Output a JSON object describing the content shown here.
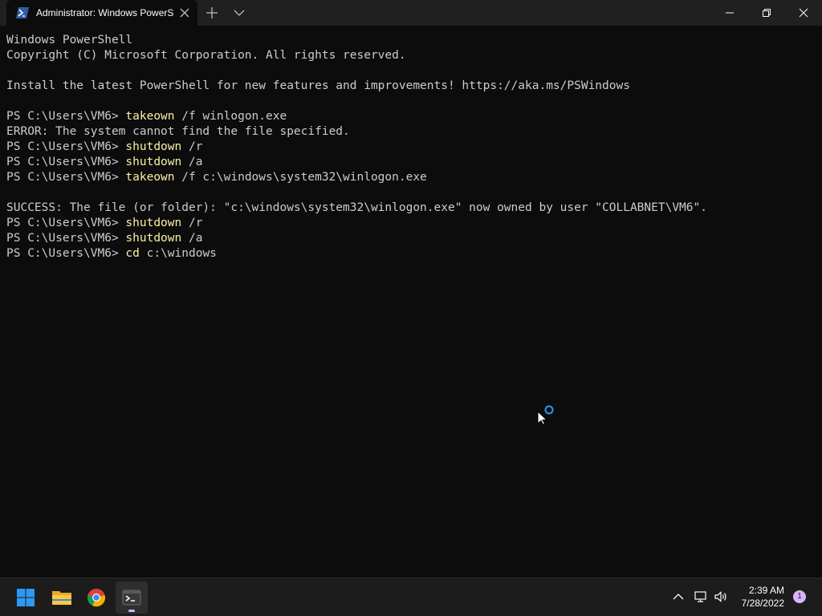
{
  "window": {
    "tab_title": "Administrator: Windows PowerS",
    "icons": {
      "tab": "powershell-icon",
      "close_tab": "close-icon",
      "new_tab": "plus-icon",
      "dropdown": "chevron-down-icon",
      "minimize": "minimize-icon",
      "maximize": "restore-icon",
      "close": "close-icon"
    }
  },
  "terminal": {
    "colors": {
      "background": "#0c0c0c",
      "text": "#cccccc",
      "command": "#f9f1a5"
    },
    "lines": [
      {
        "prompt": "",
        "command": "",
        "args": "Windows PowerShell"
      },
      {
        "prompt": "",
        "command": "",
        "args": "Copyright (C) Microsoft Corporation. All rights reserved."
      },
      {
        "prompt": "",
        "command": "",
        "args": ""
      },
      {
        "prompt": "",
        "command": "",
        "args": "Install the latest PowerShell for new features and improvements! https://aka.ms/PSWindows"
      },
      {
        "prompt": "",
        "command": "",
        "args": ""
      },
      {
        "prompt": "PS C:\\Users\\VM6> ",
        "command": "takeown",
        "args": " /f winlogon.exe"
      },
      {
        "prompt": "",
        "command": "",
        "args": "ERROR: The system cannot find the file specified."
      },
      {
        "prompt": "PS C:\\Users\\VM6> ",
        "command": "shutdown",
        "args": " /r"
      },
      {
        "prompt": "PS C:\\Users\\VM6> ",
        "command": "shutdown",
        "args": " /a"
      },
      {
        "prompt": "PS C:\\Users\\VM6> ",
        "command": "takeown",
        "args": " /f c:\\windows\\system32\\winlogon.exe"
      },
      {
        "prompt": "",
        "command": "",
        "args": ""
      },
      {
        "prompt": "",
        "command": "",
        "args": "SUCCESS: The file (or folder): \"c:\\windows\\system32\\winlogon.exe\" now owned by user \"COLLABNET\\VM6\"."
      },
      {
        "prompt": "PS C:\\Users\\VM6> ",
        "command": "shutdown",
        "args": " /r"
      },
      {
        "prompt": "PS C:\\Users\\VM6> ",
        "command": "shutdown",
        "args": " /a"
      },
      {
        "prompt": "PS C:\\Users\\VM6> ",
        "command": "cd",
        "args": " c:\\windows"
      }
    ]
  },
  "taskbar": {
    "apps": [
      {
        "name": "start",
        "icon": "windows-start-icon"
      },
      {
        "name": "file-explorer",
        "icon": "folder-icon"
      },
      {
        "name": "chrome",
        "icon": "chrome-icon"
      },
      {
        "name": "terminal",
        "icon": "terminal-icon",
        "active": true
      }
    ],
    "tray": {
      "icons": [
        "chevron-up-icon",
        "network-icon",
        "volume-icon"
      ],
      "time": "2:39 AM",
      "date": "7/28/2022",
      "notification_count": "1"
    }
  }
}
